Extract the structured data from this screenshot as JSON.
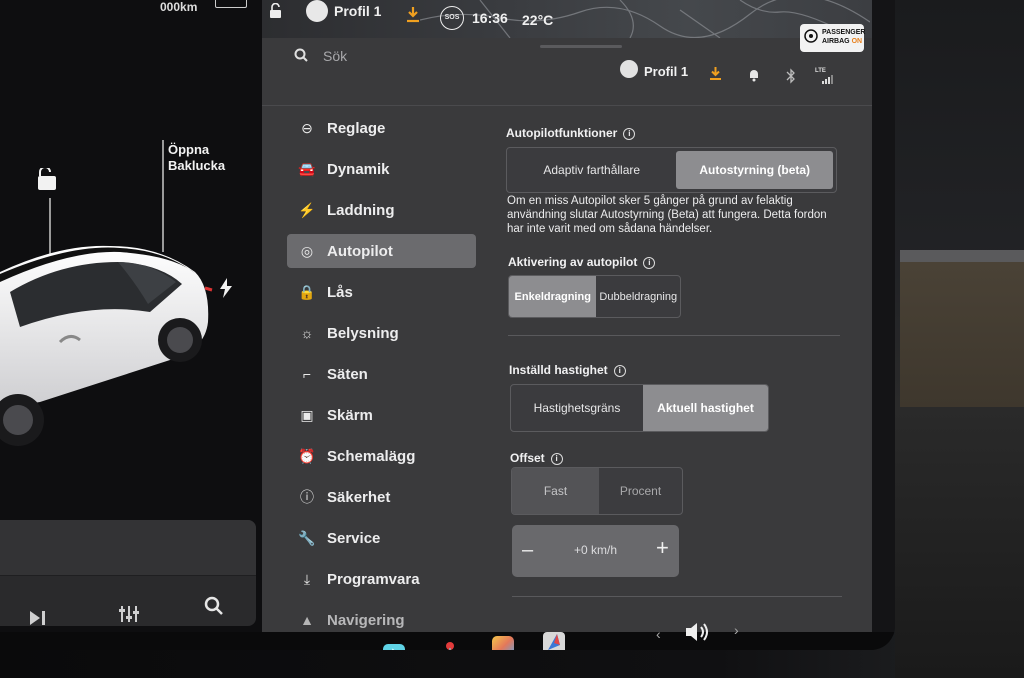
{
  "status_bar": {
    "range": "000km",
    "profile": "Profil 1",
    "sos": "SOS",
    "time": "16:36",
    "temperature": "22°C",
    "airbag_line1": "PASSENGER",
    "airbag_line2": "AIRBAG",
    "airbag_state": "ON"
  },
  "header": {
    "search_placeholder": "Sök",
    "profile": "Profil 1",
    "network": "LTE"
  },
  "car": {
    "trunk_label_1": "Öppna",
    "trunk_label_2": "Baklucka"
  },
  "nav": {
    "items": [
      {
        "label": "Reglage",
        "icon": "toggle-icon"
      },
      {
        "label": "Dynamik",
        "icon": "car-icon"
      },
      {
        "label": "Laddning",
        "icon": "bolt-icon"
      },
      {
        "label": "Autopilot",
        "icon": "steering-wheel-icon"
      },
      {
        "label": "Lås",
        "icon": "lock-icon"
      },
      {
        "label": "Belysning",
        "icon": "sun-icon"
      },
      {
        "label": "Säten",
        "icon": "seat-icon"
      },
      {
        "label": "Skärm",
        "icon": "display-icon"
      },
      {
        "label": "Schemalägg",
        "icon": "alarm-clock-icon"
      },
      {
        "label": "Säkerhet",
        "icon": "alert-icon"
      },
      {
        "label": "Service",
        "icon": "wrench-icon"
      },
      {
        "label": "Programvara",
        "icon": "download-icon"
      },
      {
        "label": "Navigering",
        "icon": "navigation-icon"
      }
    ],
    "active": "Autopilot"
  },
  "autopilot": {
    "functions_title": "Autopilotfunktioner",
    "functions_options": [
      "Adaptiv farthållare",
      "Autostyrning (beta)"
    ],
    "functions_selected": "Autostyrning (beta)",
    "description": "Om en miss Autopilot sker 5 gånger på grund av felaktig användning slutar Autostyrning (Beta) att fungera. Detta fordon har inte varit med om sådana händelser.",
    "activation_title": "Aktivering av autopilot",
    "activation_options": [
      "Enkeldragning",
      "Dubbeldragning"
    ],
    "activation_selected": "Enkeldragning",
    "speed_title": "Inställd hastighet",
    "speed_options": [
      "Hastighetsgräns",
      "Aktuell hastighet"
    ],
    "speed_selected": "Aktuell hastighet",
    "offset_title": "Offset",
    "offset_options": [
      "Fast",
      "Procent"
    ],
    "offset_selected": "Fast",
    "offset_value": "+0 km/h",
    "minus": "–",
    "plus": "+"
  },
  "colors": {
    "accent_download": "#f0a020",
    "airbag_on": "#e8801c"
  }
}
